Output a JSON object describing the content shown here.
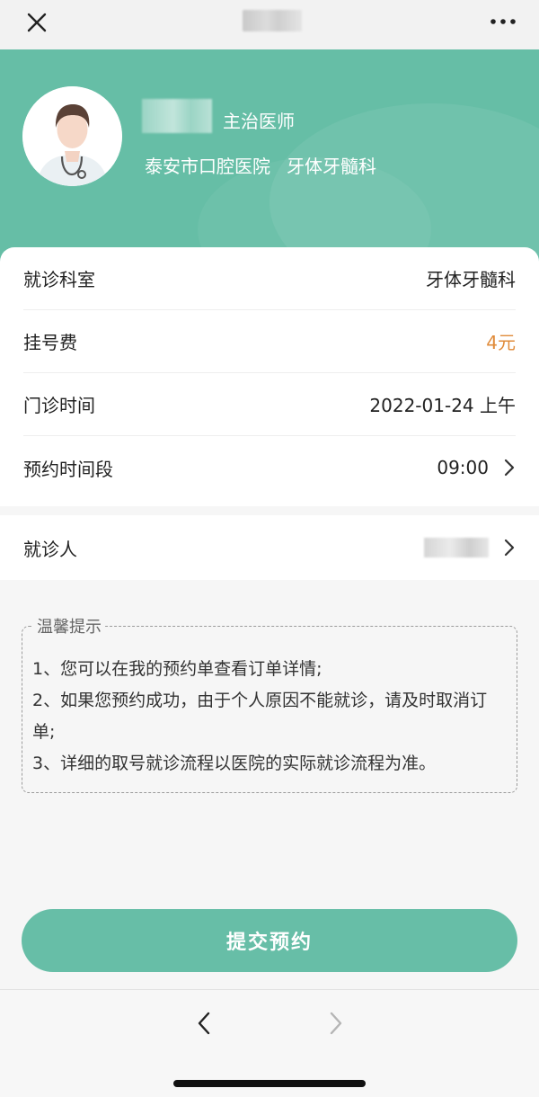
{
  "topbar": {
    "close_icon": "close-icon",
    "title": "",
    "more_icon": "more-icon"
  },
  "doctor": {
    "name": "",
    "title": "主治医师",
    "hospital": "泰安市口腔医院",
    "department": "牙体牙髓科"
  },
  "info_rows": [
    {
      "label": "就诊科室",
      "value": "牙体牙髓科"
    },
    {
      "label": "挂号费",
      "value": "4元"
    },
    {
      "label": "门诊时间",
      "value": "2022-01-24 上午"
    },
    {
      "label": "预约时间段",
      "value": "09:00"
    }
  ],
  "patient": {
    "label": "就诊人",
    "value": ""
  },
  "tips": {
    "title": "温馨提示",
    "lines": [
      "1、您可以在我的预约单查看订单详情;",
      "2、如果您预约成功，由于个人原因不能就诊，请及时取消订单;",
      "3、详细的取号就诊流程以医院的实际就诊流程为准。"
    ]
  },
  "submit": {
    "label": "提交预约"
  },
  "colors": {
    "accent": "#66bea6",
    "fee": "#e08b3a"
  }
}
